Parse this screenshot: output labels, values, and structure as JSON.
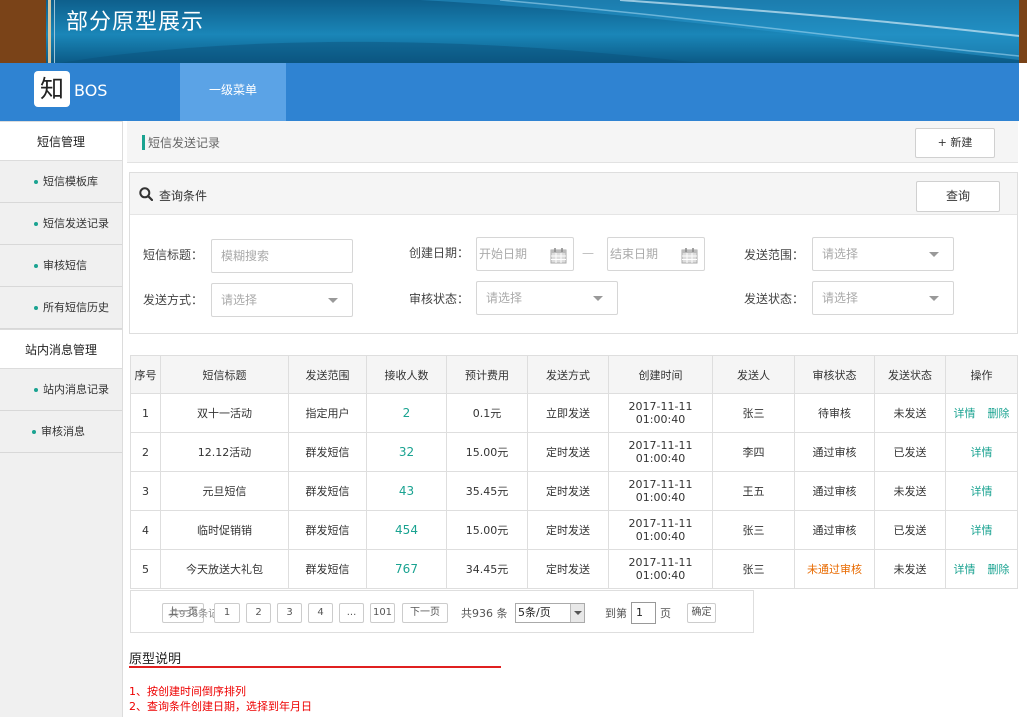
{
  "banner": {
    "title": "部分原型展示"
  },
  "header": {
    "logo_char": "知",
    "logo_text": "BOS",
    "menu_l1": "一级菜单"
  },
  "sidebar": {
    "groups": [
      {
        "label": "短信管理",
        "items": [
          "短信模板库",
          "短信发送记录",
          "审核短信",
          "所有短信历史"
        ]
      },
      {
        "label": "站内消息管理",
        "items": [
          "站内消息记录",
          "审核消息"
        ]
      }
    ]
  },
  "breadcrumb": {
    "current": "短信发送记录"
  },
  "actions": {
    "new_label": "+ 新建"
  },
  "query": {
    "title": "查询条件",
    "query_btn": "查询",
    "title_label": "短信标题：",
    "title_placeholder": "模糊搜索",
    "date_label": "创建日期：",
    "start_placeholder": "开始日期",
    "dash": "—",
    "end_placeholder": "结束日期",
    "scope_label": "发送范围：",
    "method_label": "发送方式：",
    "review_label": "审核状态：",
    "send_label": "发送状态：",
    "select_placeholder": "请选择"
  },
  "table": {
    "headers": [
      "序号",
      "短信标题",
      "发送范围",
      "接收人数",
      "预计费用",
      "发送方式",
      "创建时间",
      "发送人",
      "审核状态",
      "发送状态",
      "操作"
    ],
    "rows": [
      {
        "no": "1",
        "title": "双十一活动",
        "scope": "指定用户",
        "count": "2",
        "cost": "0.1元",
        "method": "立即发送",
        "date": "2017-11-11",
        "time": "01:00:40",
        "sender": "张三",
        "review": "待审核",
        "status": "未发送",
        "ops": [
          "详情",
          "删除"
        ]
      },
      {
        "no": "2",
        "title": "12.12活动",
        "scope": "群发短信",
        "count": "32",
        "cost": "15.00元",
        "method": "定时发送",
        "date": "2017-11-11",
        "time": "01:00:40",
        "sender": "李四",
        "review": "通过审核",
        "status": "已发送",
        "ops": [
          "详情"
        ]
      },
      {
        "no": "3",
        "title": "元旦短信",
        "scope": "群发短信",
        "count": "43",
        "cost": "35.45元",
        "method": "定时发送",
        "date": "2017-11-11",
        "time": "01:00:40",
        "sender": "王五",
        "review": "通过审核",
        "status": "未发送",
        "ops": [
          "详情"
        ]
      },
      {
        "no": "4",
        "title": "临时促销销",
        "scope": "群发短信",
        "count": "454",
        "cost": "15.00元",
        "method": "定时发送",
        "date": "2017-11-11",
        "time": "01:00:40",
        "sender": "张三",
        "review": "通过审核",
        "status": "已发送",
        "ops": [
          "详情"
        ]
      },
      {
        "no": "5",
        "title": "今天放送大礼包",
        "scope": "群发短信",
        "count": "767",
        "cost": "34.45元",
        "method": "定时发送",
        "date": "2017-11-11",
        "time": "01:00:40",
        "sender": "张三",
        "review": "未通过审核",
        "status": "未发送",
        "ops": [
          "详情",
          "删除"
        ]
      }
    ]
  },
  "pager": {
    "prev": "上一页",
    "overlay": "共936条记录",
    "pages": [
      "1",
      "2",
      "3",
      "4",
      "...",
      "101"
    ],
    "next": "下一页",
    "total": "共936 条",
    "page_size": "5条/页",
    "goto_prefix": "到第",
    "goto_value": "1",
    "goto_suffix": "页",
    "confirm": "确定"
  },
  "notes": {
    "title": "原型说明",
    "lines": [
      "1、按创建时间倒序排列",
      "2、查询条件创建日期，选择到年月日"
    ]
  },
  "colors": {
    "nav": "#2f83d2",
    "accent": "#1aa391",
    "warn": "#e86a00",
    "note": "#e00000"
  }
}
